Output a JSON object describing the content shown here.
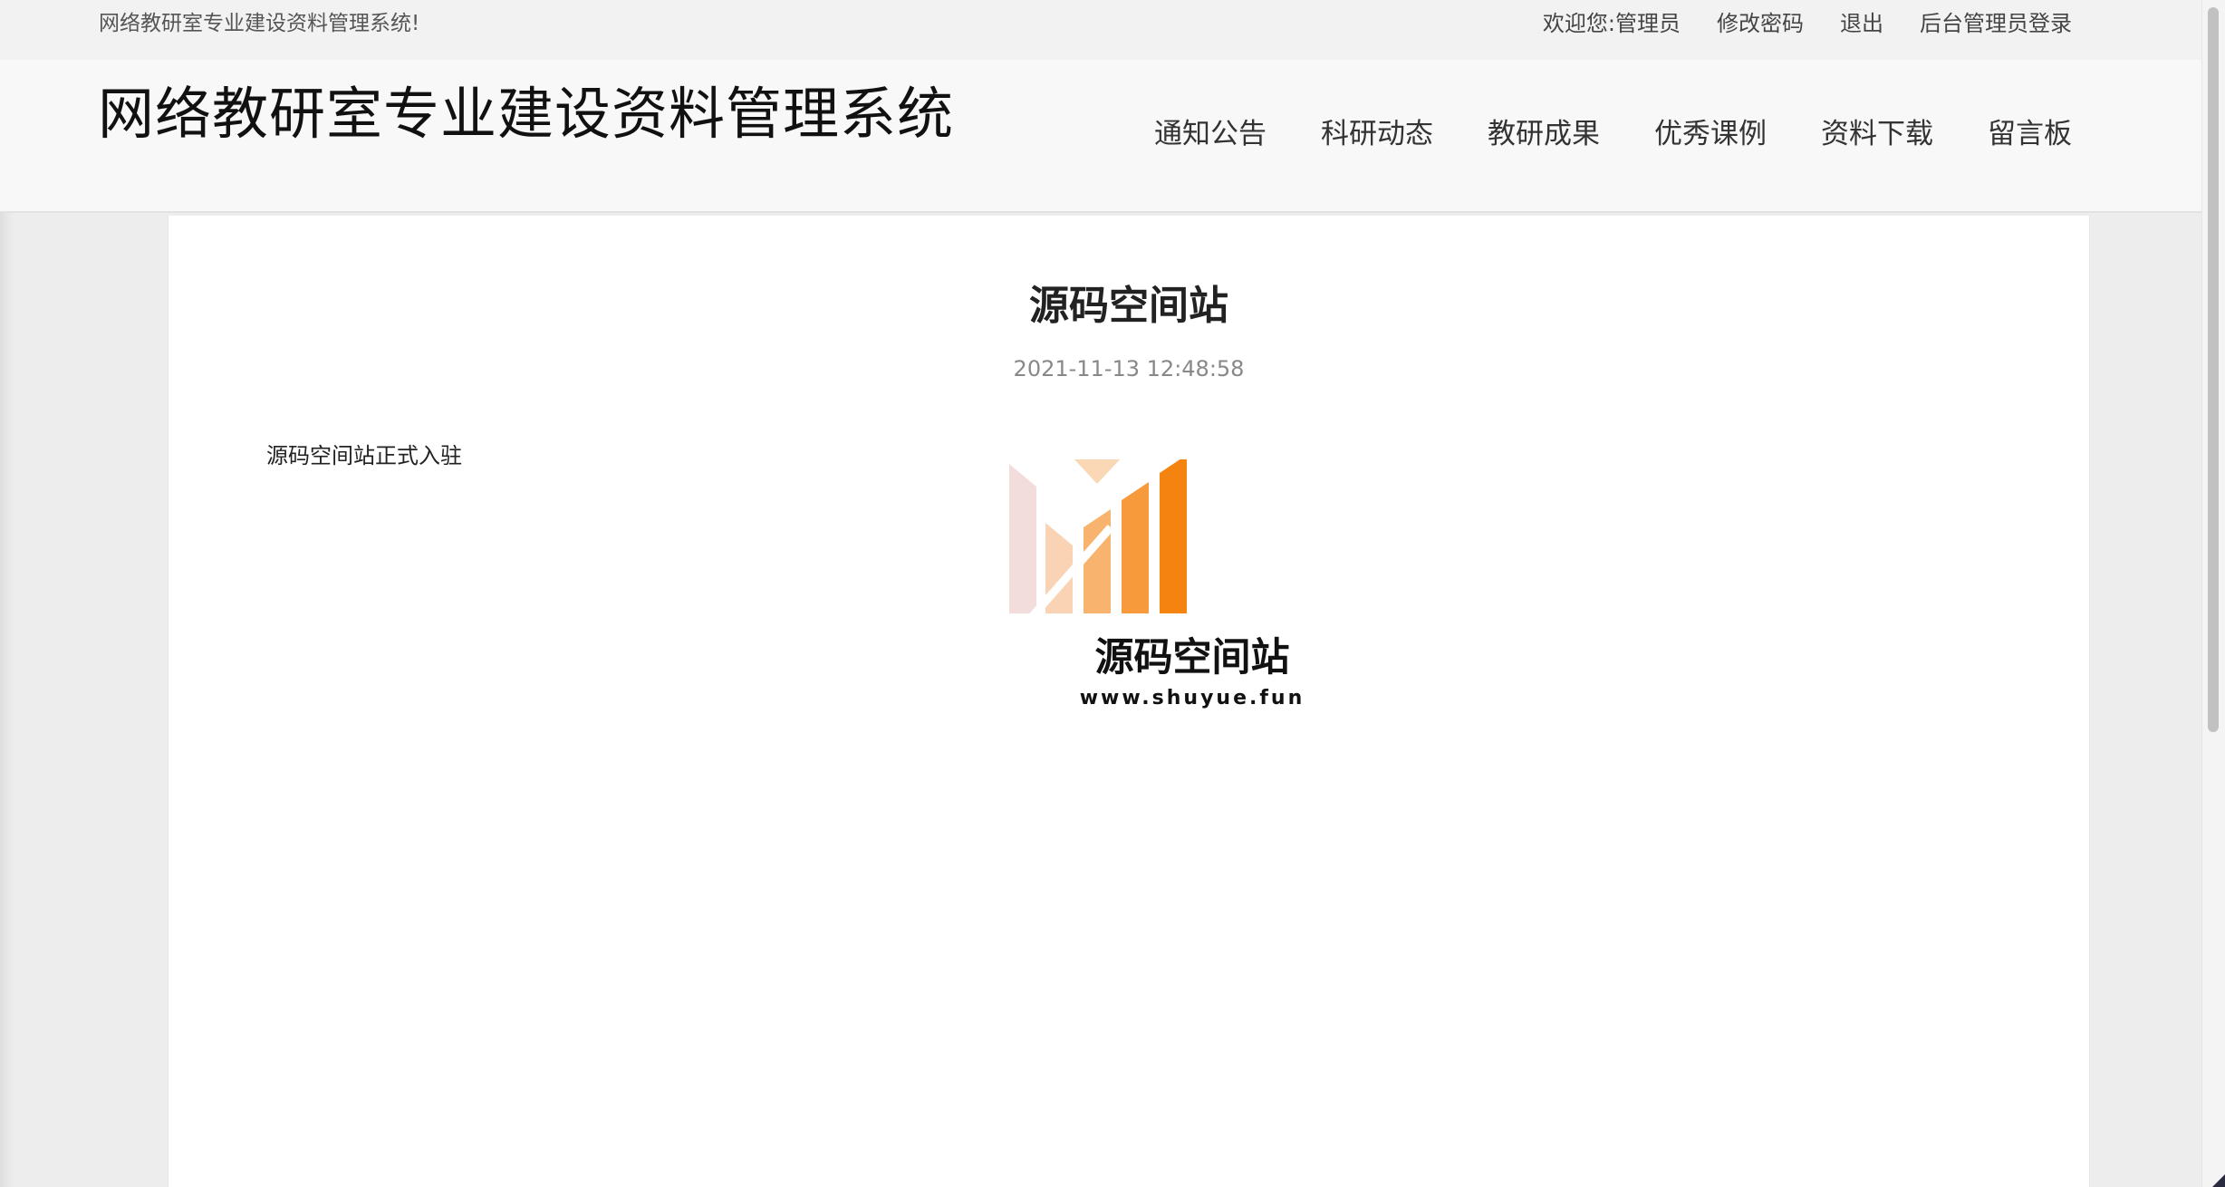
{
  "topbar": {
    "welcome_text": "网络教研室专业建设资料管理系统!",
    "greeting_prefix": "欢迎您:",
    "username": "管理员",
    "change_password": "修改密码",
    "logout": "退出",
    "admin_login": "后台管理员登录"
  },
  "header": {
    "site_title": "网络教研室专业建设资料管理系统",
    "nav": [
      {
        "label": "通知公告"
      },
      {
        "label": "科研动态"
      },
      {
        "label": "教研成果"
      },
      {
        "label": "优秀课例"
      },
      {
        "label": "资料下载"
      },
      {
        "label": "留言板"
      }
    ]
  },
  "article": {
    "title": "源码空间站",
    "date": "2021-11-13 12:48:58",
    "body_text": "源码空间站正式入驻",
    "logo": {
      "name": "源码空间站",
      "url": "www.shuyue.fun",
      "colors": [
        "#f3dcdc",
        "#f9d3b3",
        "#f8b46e",
        "#f69a3c",
        "#f5830f",
        "#fad8b6"
      ]
    }
  }
}
